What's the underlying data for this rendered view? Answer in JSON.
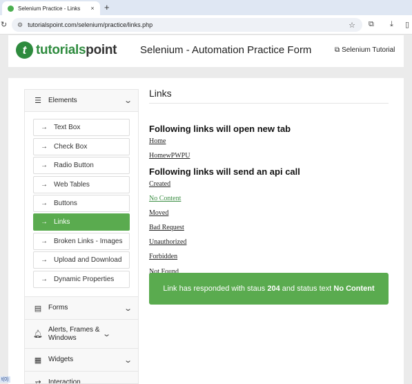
{
  "browser": {
    "tab_title": "Selenium Practice - Links",
    "tab_close": "×",
    "new_tab": "+",
    "url": "tutorialspoint.com/selenium/practice/links.php"
  },
  "site": {
    "logo_part1": "tutorials",
    "logo_part2": "point",
    "logo_mark": "t",
    "page_heading": "Selenium - Automation Practice Form",
    "tutorial_link": "Selenium Tutorial"
  },
  "sidebar": {
    "elements_label": "Elements",
    "items": [
      {
        "label": "Text Box"
      },
      {
        "label": "Check Box"
      },
      {
        "label": "Radio Button"
      },
      {
        "label": "Web Tables"
      },
      {
        "label": "Buttons"
      },
      {
        "label": "Links",
        "active": true
      },
      {
        "label": "Broken Links - Images"
      },
      {
        "label": "Upload and Download"
      },
      {
        "label": "Dynamic Properties"
      }
    ],
    "sections": [
      {
        "label": "Forms",
        "icon": "form-icon"
      },
      {
        "label": "Alerts, Frames & Windows",
        "icon": "bell-icon"
      },
      {
        "label": "Widgets",
        "icon": "widgets-icon"
      },
      {
        "label": "Interaction",
        "icon": "arrows-icon"
      }
    ]
  },
  "main": {
    "title": "Links",
    "heading_new_tab": "Following links will open new tab",
    "new_tab_links": [
      "Home",
      "HomewPWPU"
    ],
    "heading_api": "Following links will send an api call",
    "api_links": [
      "Created",
      "No Content",
      "Moved",
      "Bad Request",
      "Unauthorized",
      "Forbidden",
      "Not Found"
    ],
    "alert": {
      "prefix": "Link has responded with staus ",
      "status_code": "204",
      "middle": " and status text ",
      "status_text": "No Content"
    }
  },
  "status_tag": "t(0)",
  "colors": {
    "brand_green": "#2e8b3e",
    "active_green": "#5aab4f"
  }
}
